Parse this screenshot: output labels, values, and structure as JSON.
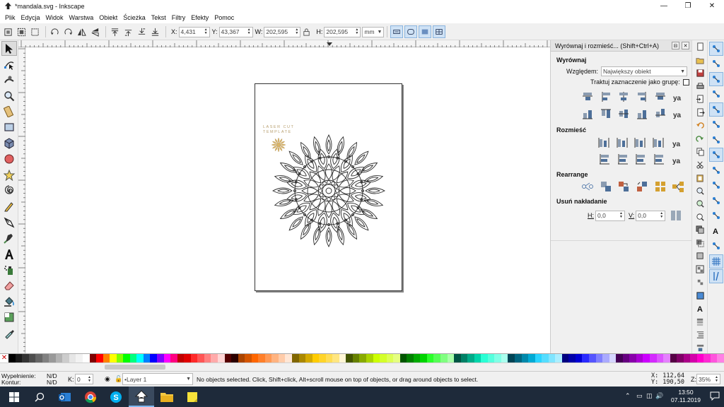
{
  "window": {
    "title": "*mandala.svg - Inkscape",
    "controls": [
      "—",
      "❐",
      "✕"
    ]
  },
  "menu": [
    "Plik",
    "Edycja",
    "Widok",
    "Warstwa",
    "Obiekt",
    "Ścieżka",
    "Tekst",
    "Filtry",
    "Efekty",
    "Pomoc"
  ],
  "toolbar": {
    "x_label": "X:",
    "x_value": "4,431",
    "y_label": "Y:",
    "y_value": "43,367",
    "w_label": "W:",
    "w_value": "202,595",
    "h_label": "H:",
    "h_value": "202,595",
    "unit": "mm"
  },
  "document": {
    "caption_line1": "LASER CUT",
    "caption_line2": "TEMPLATE"
  },
  "dock": {
    "title": "Wyrównaj i rozmieść... (Shift+Ctrl+A)",
    "align_section": "Wyrównaj",
    "relative_label": "Względem:",
    "relative_value": "Największy obiekt",
    "group_label": "Traktuj zaznaczenie jako grupę:",
    "distribute_section": "Rozmieść",
    "rearrange_section": "Rearrange",
    "overlap_section": "Usuń nakładanie",
    "h_label": "H:",
    "h_value": "0,0",
    "v_label": "V:",
    "v_value": "0,0"
  },
  "status": {
    "fill_label": "Wypełnienie:",
    "fill_value": "N/D",
    "stroke_label": "Kontur:",
    "stroke_value": "N/D",
    "opacity_label": "K:",
    "opacity_value": "0",
    "layer": "•Layer 1",
    "message": "No objects selected. Click, Shift+click, Alt+scroll mouse on top of objects, or drag around objects to select.",
    "cursor_x_label": "X:",
    "cursor_x": "112,64",
    "cursor_y_label": "Y:",
    "cursor_y": "190,50",
    "zoom_label": "Z:",
    "zoom": "35%"
  },
  "taskbar": {
    "time": "13:50",
    "date": "07.11.2019"
  },
  "palette_colors": [
    "#000000",
    "#1a1a1a",
    "#333333",
    "#4d4d4d",
    "#666666",
    "#808080",
    "#999999",
    "#b3b3b3",
    "#cccccc",
    "#e6e6e6",
    "#f2f2f2",
    "#ffffff",
    "#800000",
    "#ff0000",
    "#ff8000",
    "#ffff00",
    "#80ff00",
    "#00ff00",
    "#00ff80",
    "#00ffff",
    "#0080ff",
    "#0000ff",
    "#8000ff",
    "#ff00ff",
    "#ff0080",
    "#c00000",
    "#e00000",
    "#ff2a2a",
    "#ff5555",
    "#ff8080",
    "#ffaaaa",
    "#ffd5d5",
    "#550000",
    "#2b0000",
    "#aa4400",
    "#d45500",
    "#ff6600",
    "#ff7f2a",
    "#ff9955",
    "#ffb380",
    "#ffccaa",
    "#ffe6d5",
    "#806600",
    "#aa8800",
    "#d4aa00",
    "#ffcc00",
    "#ffd42a",
    "#ffdd55",
    "#ffe680",
    "#fff6d5",
    "#445500",
    "#668000",
    "#88aa00",
    "#aad400",
    "#ccff00",
    "#d4ff2a",
    "#ddff55",
    "#e5ff80",
    "#005500",
    "#008000",
    "#00aa00",
    "#00d400",
    "#2aff2a",
    "#55ff55",
    "#80ff80",
    "#aaffaa",
    "#005544",
    "#008066",
    "#00aa88",
    "#00d4aa",
    "#2affd5",
    "#55ffdd",
    "#80ffe6",
    "#aaffee",
    "#004455",
    "#006680",
    "#0088aa",
    "#00aad4",
    "#2ad4ff",
    "#55ddff",
    "#80e5ff",
    "#aaeeff",
    "#000080",
    "#0000aa",
    "#0000d4",
    "#2a2aff",
    "#5555ff",
    "#8080ff",
    "#aaaaff",
    "#d5d5ff",
    "#440055",
    "#660080",
    "#8800aa",
    "#aa00d4",
    "#cc00ff",
    "#d42aff",
    "#dd55ff",
    "#e580ff",
    "#550044",
    "#800066",
    "#aa0088",
    "#d400aa",
    "#ff00cc",
    "#ff2ad4",
    "#ff55dd",
    "#ff80e5"
  ]
}
